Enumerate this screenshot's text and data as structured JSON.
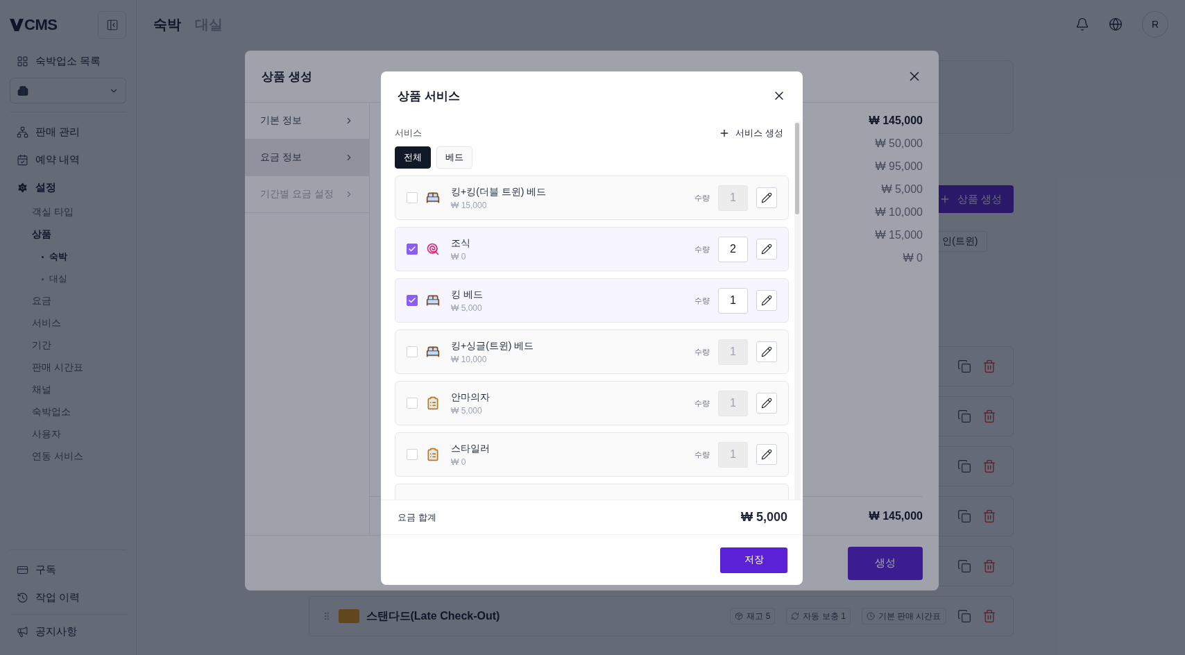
{
  "sidebar": {
    "logo": "CMS",
    "property_list": "숙박업소 목록",
    "nav": [
      {
        "kind": "sales",
        "label": "판매 관리",
        "selected": false
      },
      {
        "kind": "reservations",
        "label": "예약 내역",
        "selected": false
      },
      {
        "kind": "settings",
        "label": "설정",
        "selected": true,
        "children": [
          {
            "label": "객실 타입",
            "selected": false
          },
          {
            "label": "상품",
            "selected": true,
            "children": [
              {
                "label": "숙박",
                "selected": true
              },
              {
                "label": "대실",
                "selected": false
              }
            ]
          },
          {
            "label": "요금",
            "selected": false
          },
          {
            "label": "서비스",
            "selected": false
          },
          {
            "label": "기간",
            "selected": false
          },
          {
            "label": "판매 시간표",
            "selected": false
          },
          {
            "label": "채널",
            "selected": false
          },
          {
            "label": "숙박업소",
            "selected": false
          },
          {
            "label": "사용자",
            "selected": false
          },
          {
            "label": "연동 서비스",
            "selected": false
          }
        ]
      }
    ],
    "bottom_nav": [
      {
        "kind": "subscription",
        "label": "구독"
      },
      {
        "kind": "history",
        "label": "작업 이력"
      },
      {
        "kind": "notice",
        "label": "공지사항"
      }
    ]
  },
  "header": {
    "tabs": [
      {
        "label": "숙박",
        "selected": true
      },
      {
        "label": "대실",
        "selected": false
      }
    ],
    "avatar": "R"
  },
  "page": {
    "create_button": "상품 생성",
    "chip": "인(트윈)",
    "product": {
      "name": "스탠다드(Late Check-Out)",
      "meta": [
        {
          "kind": "stock",
          "label": "재고 5"
        },
        {
          "kind": "refill",
          "label": "자동 보충 1"
        },
        {
          "kind": "schedule",
          "label": "기본 판매 시간표"
        }
      ]
    }
  },
  "product_modal": {
    "title": "상품 생성",
    "steps": [
      {
        "label": "기본 정보",
        "selected": false,
        "disabled": false
      },
      {
        "label": "요금 정보",
        "selected": true,
        "disabled": false
      },
      {
        "label": "기간별 요금 설정",
        "selected": false,
        "disabled": true
      }
    ],
    "prices": [
      {
        "kind": "total",
        "value": "₩ 145,000"
      },
      {
        "kind": "item",
        "value": "₩ 50,000"
      },
      {
        "kind": "item",
        "value": "₩ 95,000"
      },
      {
        "kind": "item",
        "value": "₩ 5,000"
      },
      {
        "kind": "item",
        "value": "₩ 10,000"
      },
      {
        "kind": "item",
        "value": "₩ 15,000"
      },
      {
        "kind": "item",
        "value": "₩ 0"
      }
    ],
    "total": "₩ 145,000",
    "submit": "생성"
  },
  "service_dialog": {
    "title": "상품 서비스",
    "section_label": "서비스",
    "create_link": "서비스 생성",
    "filters": [
      {
        "label": "전체",
        "selected": true
      },
      {
        "label": "베드",
        "selected": false
      }
    ],
    "services": [
      {
        "kind": "bed",
        "name": "킹+킹(더블 트윈) 베드",
        "price": "₩ 15,000",
        "checked": false,
        "quantity_label": "수량",
        "quantity": "1"
      },
      {
        "kind": "food",
        "name": "조식",
        "price": "₩ 0",
        "checked": true,
        "quantity_label": "수량",
        "quantity": "2"
      },
      {
        "kind": "bed",
        "name": "킹 베드",
        "price": "₩ 5,000",
        "checked": true,
        "quantity_label": "수량",
        "quantity": "1"
      },
      {
        "kind": "bed",
        "name": "킹+싱글(트윈) 베드",
        "price": "₩ 10,000",
        "checked": false,
        "quantity_label": "수량",
        "quantity": "1"
      },
      {
        "kind": "amenity",
        "name": "안마의자",
        "price": "₩ 5,000",
        "checked": false,
        "quantity_label": "수량",
        "quantity": "1"
      },
      {
        "kind": "amenity",
        "name": "스타일러",
        "price": "₩ 0",
        "checked": false,
        "quantity_label": "수량",
        "quantity": "1"
      }
    ],
    "total_label": "요금 합계",
    "total": "₩ 5,000",
    "save": "저장"
  }
}
